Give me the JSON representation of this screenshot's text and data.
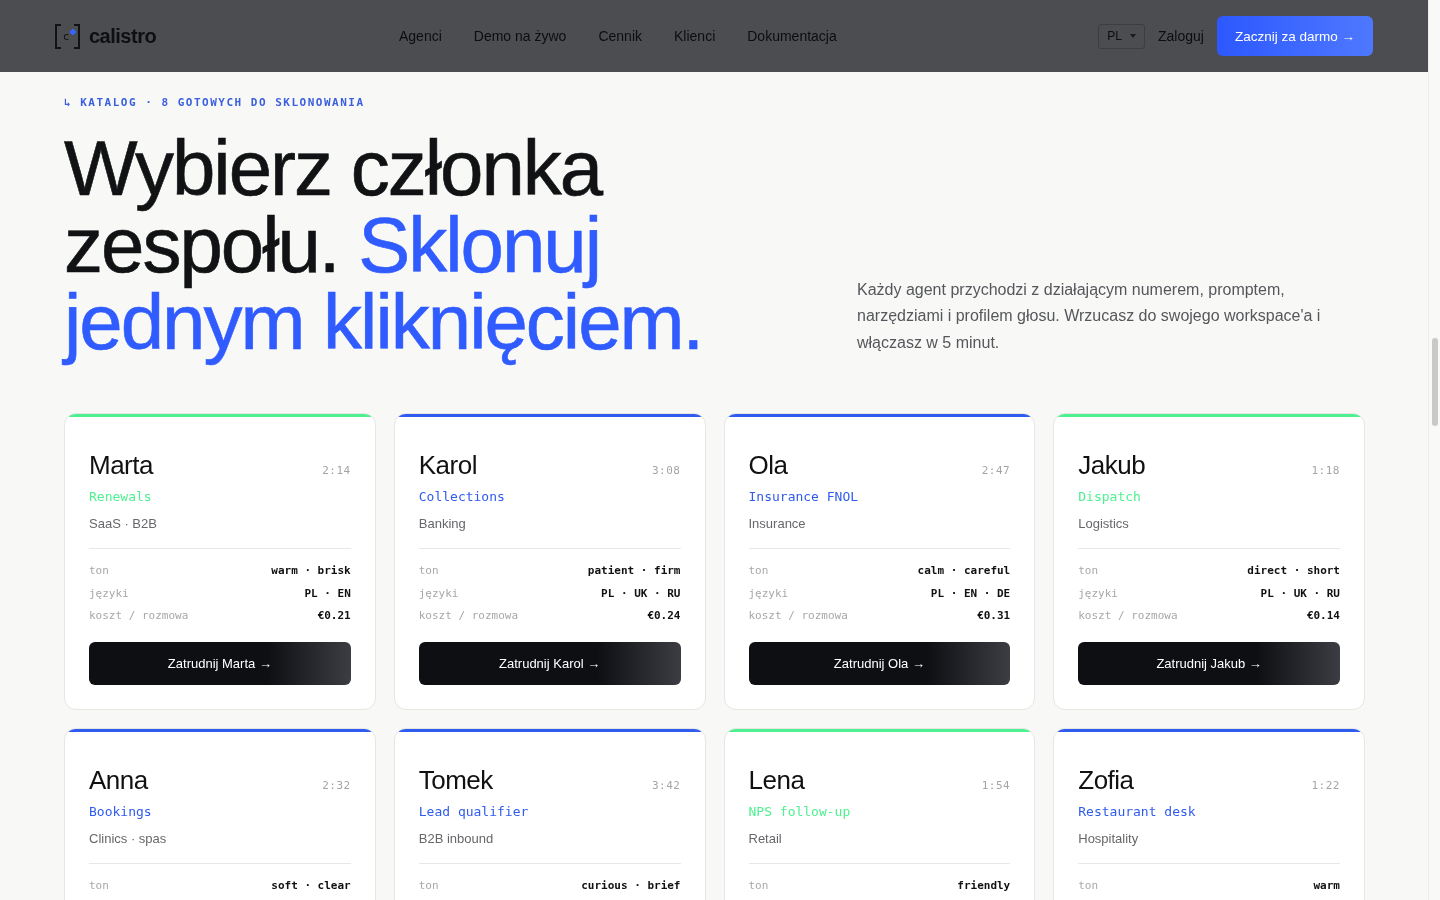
{
  "nav": {
    "logo": {
      "mark": "c",
      "name": "calistro"
    },
    "links": [
      "Agenci",
      "Demo na żywo",
      "Cennik",
      "Klienci",
      "Dokumentacja"
    ],
    "language": "PL",
    "login": "Zaloguj",
    "cta": "Zacznij za darmo →"
  },
  "hero": {
    "eyebrow": "↳ KATALOG · 8 GOTOWYCH DO SKLONOWANIA",
    "heading": [
      {
        "text": "Wybierz członka zespołu.",
        "accent": false
      },
      {
        "text": "Sklonuj jednym kliknięciem.",
        "accent": true
      }
    ],
    "intro": "Każdy agent przychodzi z działającym numerem, promptem, narzędziami i profilem głosu. Wrzucasz do swojego workspace'a i włączasz w 5 minut."
  },
  "agents": [
    {
      "name": "Marta",
      "duration": "2:14",
      "role": "Renewals",
      "industry": "SaaS · B2B",
      "color": "#4ef08f",
      "specs": [
        {
          "label": "ton",
          "value": "warm · brisk"
        },
        {
          "label": "języki",
          "value": "PL · EN"
        },
        {
          "label": "koszt / rozmowa",
          "value": "€0.21"
        }
      ],
      "button": "Zatrudnij Marta →"
    },
    {
      "name": "Karol",
      "duration": "3:08",
      "role": "Collections",
      "industry": "Banking",
      "color": "#2f5bef",
      "specs": [
        {
          "label": "ton",
          "value": "patient · firm"
        },
        {
          "label": "języki",
          "value": "PL · UK · RU"
        },
        {
          "label": "koszt / rozmowa",
          "value": "€0.24"
        }
      ],
      "button": "Zatrudnij Karol →"
    },
    {
      "name": "Ola",
      "duration": "2:47",
      "role": "Insurance FNOL",
      "industry": "Insurance",
      "color": "#2f5bef",
      "specs": [
        {
          "label": "ton",
          "value": "calm · careful"
        },
        {
          "label": "języki",
          "value": "PL · EN · DE"
        },
        {
          "label": "koszt / rozmowa",
          "value": "€0.31"
        }
      ],
      "button": "Zatrudnij Ola →"
    },
    {
      "name": "Jakub",
      "duration": "1:18",
      "role": "Dispatch",
      "industry": "Logistics",
      "color": "#4ef08f",
      "specs": [
        {
          "label": "ton",
          "value": "direct · short"
        },
        {
          "label": "języki",
          "value": "PL · UK · RU"
        },
        {
          "label": "koszt / rozmowa",
          "value": "€0.14"
        }
      ],
      "button": "Zatrudnij Jakub →"
    },
    {
      "name": "Anna",
      "duration": "2:32",
      "role": "Bookings",
      "industry": "Clinics · spas",
      "color": "#2f5bef",
      "specs": [
        {
          "label": "ton",
          "value": "soft · clear"
        }
      ]
    },
    {
      "name": "Tomek",
      "duration": "3:42",
      "role": "Lead qualifier",
      "industry": "B2B inbound",
      "color": "#2f5bef",
      "specs": [
        {
          "label": "ton",
          "value": "curious · brief"
        }
      ]
    },
    {
      "name": "Lena",
      "duration": "1:54",
      "role": "NPS follow-up",
      "industry": "Retail",
      "color": "#4ef08f",
      "specs": [
        {
          "label": "ton",
          "value": "friendly"
        }
      ]
    },
    {
      "name": "Zofia",
      "duration": "1:22",
      "role": "Restaurant desk",
      "industry": "Hospitality",
      "color": "#2f5bef",
      "specs": [
        {
          "label": "ton",
          "value": "warm"
        }
      ]
    }
  ]
}
